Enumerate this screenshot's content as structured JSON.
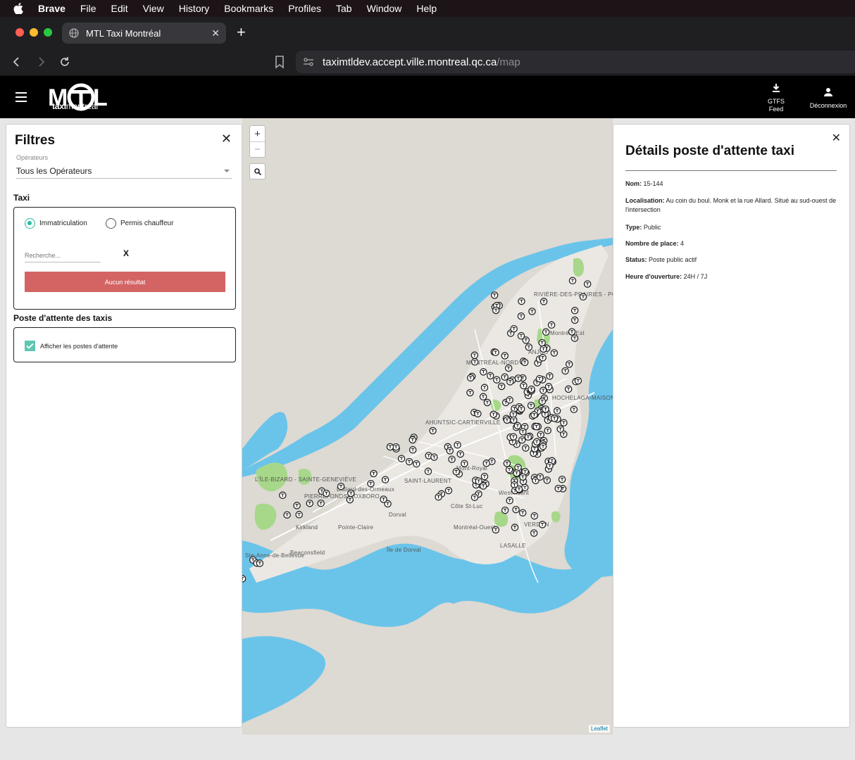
{
  "menubar": {
    "app": "Brave",
    "items": [
      "File",
      "Edit",
      "View",
      "History",
      "Bookmarks",
      "Profiles",
      "Tab",
      "Window",
      "Help"
    ]
  },
  "browser": {
    "tab_title": "MTL Taxi Montréal",
    "url_host": "taximtldev.accept.ville.montreal.qc.ca",
    "url_path": "/map"
  },
  "header": {
    "logo_word": "MTL",
    "logo_sub_bold": "taxi",
    "logo_sub": "montréal",
    "gtfs_label_1": "GTFS",
    "gtfs_label_2": "Feed",
    "login_label": "Déconnexion"
  },
  "filters": {
    "title": "Filtres",
    "operator_label": "Opérateurs",
    "operator_value": "Tous les Opérateurs",
    "taxi_section": "Taxi",
    "radio_plate": "Immatriculation",
    "radio_permit": "Permis chauffeur",
    "search_placeholder": "Recherche...",
    "clear_label": "X",
    "no_result": "Aucun résultat",
    "stands_section": "Poste d'attente des taxis",
    "show_stands": "Afficher les postes d'attente"
  },
  "map": {
    "zoom_in": "+",
    "zoom_out": "−",
    "attribution": "Leaflet",
    "labels": [
      "RIVIÈRE-DES-PRAIRIES - POINTE-AUX-TREMBLES",
      "Montréal-Est",
      "ANJOU",
      "MONTRÉAL-NORD",
      "AHUNTSIC-CARTIERVILLE",
      "HOCHELAGA-MAISONNEUVE",
      "SAINT-LAURENT",
      "L'ÎLE-BIZARD - SAINTE-GENEVIÈVE",
      "PIERREFONDS-ROXBORO",
      "Kirkland",
      "Dorval",
      "Côte St-Luc",
      "Montréal-Ouest",
      "Beaconsfield",
      "Ste-Anne-de-Bellevue",
      "Île de Dorval",
      "Pointe-Claire",
      "Dollard-des-Ormeaux",
      "LASALLE",
      "Mont-Royal",
      "Westmount",
      "VERDUN"
    ]
  },
  "details": {
    "title": "Détails poste d'attente taxi",
    "rows": [
      {
        "label": "Nom:",
        "value": "15-144"
      },
      {
        "label": "Localisation:",
        "value": "Au coin du boul. Monk et la rue Allard. Situé au sud-ouest de l'intersection"
      },
      {
        "label": "Type:",
        "value": "Public"
      },
      {
        "label": "Nombre de place:",
        "value": "4"
      },
      {
        "label": "Status:",
        "value": "Poste public actif"
      },
      {
        "label": "Heure d'ouverture:",
        "value": "24H / 7J"
      }
    ]
  },
  "colors": {
    "water": "#6ac4ea",
    "land": "#ddd9d3",
    "park": "#a7d88a",
    "accent": "#2bbba0",
    "danger": "#d46464"
  }
}
